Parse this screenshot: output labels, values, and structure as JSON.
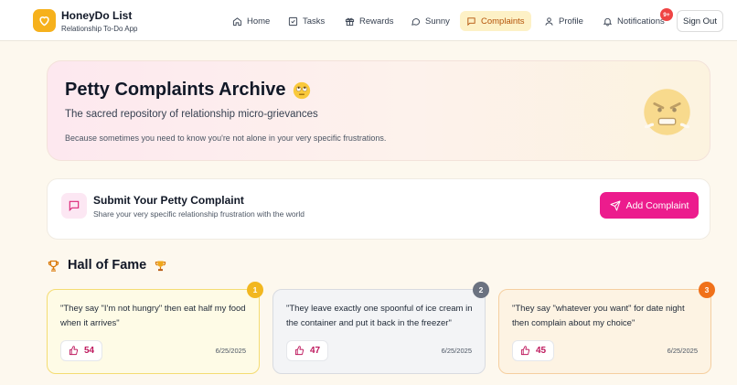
{
  "app": {
    "name": "HoneyDo List",
    "tagline": "Relationship To-Do App"
  },
  "nav": {
    "items": [
      {
        "label": "Home",
        "icon": "home-icon",
        "active": false
      },
      {
        "label": "Tasks",
        "icon": "checkbox-icon",
        "active": false
      },
      {
        "label": "Rewards",
        "icon": "gift-icon",
        "active": false
      },
      {
        "label": "Sunny",
        "icon": "chat-bubble-icon",
        "active": false
      },
      {
        "label": "Complaints",
        "icon": "message-square-icon",
        "active": true
      },
      {
        "label": "Profile",
        "icon": "user-icon",
        "active": false
      },
      {
        "label": "Notifications",
        "icon": "bell-icon",
        "active": false
      }
    ],
    "notification_badge": "9+",
    "signout_label": "Sign Out"
  },
  "hero": {
    "title": "Petty Complaints Archive",
    "title_emoji": "eye-roll-face-icon",
    "subtitle": "The sacred repository of relationship micro-grievances",
    "note": "Because sometimes you need to know you're not alone in your very specific frustrations.",
    "decoration": "angry-face-icon"
  },
  "submit": {
    "title": "Submit Your Petty Complaint",
    "subtitle": "Share your very specific relationship frustration with the world",
    "button_label": "Add Complaint"
  },
  "hall_of_fame": {
    "title": "Hall of Fame",
    "cards": [
      {
        "rank": "1",
        "text": "\"They say \"I'm not hungry\" then eat half my food when it arrives\"",
        "votes": "54",
        "date": "6/25/2025"
      },
      {
        "rank": "2",
        "text": "\"They leave exactly one spoonful of ice cream in the container and put it back in the freezer\"",
        "votes": "47",
        "date": "6/25/2025"
      },
      {
        "rank": "3",
        "text": "\"They say \"whatever you want\" for date night then complain about my choice\"",
        "votes": "45",
        "date": "6/25/2025"
      }
    ]
  },
  "colors": {
    "brand": "#f6b11c",
    "accent": "#ec1c8d",
    "active_nav_bg": "#fdf1c6",
    "rank_gold": "#f2b720",
    "rank_silver": "#6b7280",
    "rank_bronze": "#f0711a"
  }
}
